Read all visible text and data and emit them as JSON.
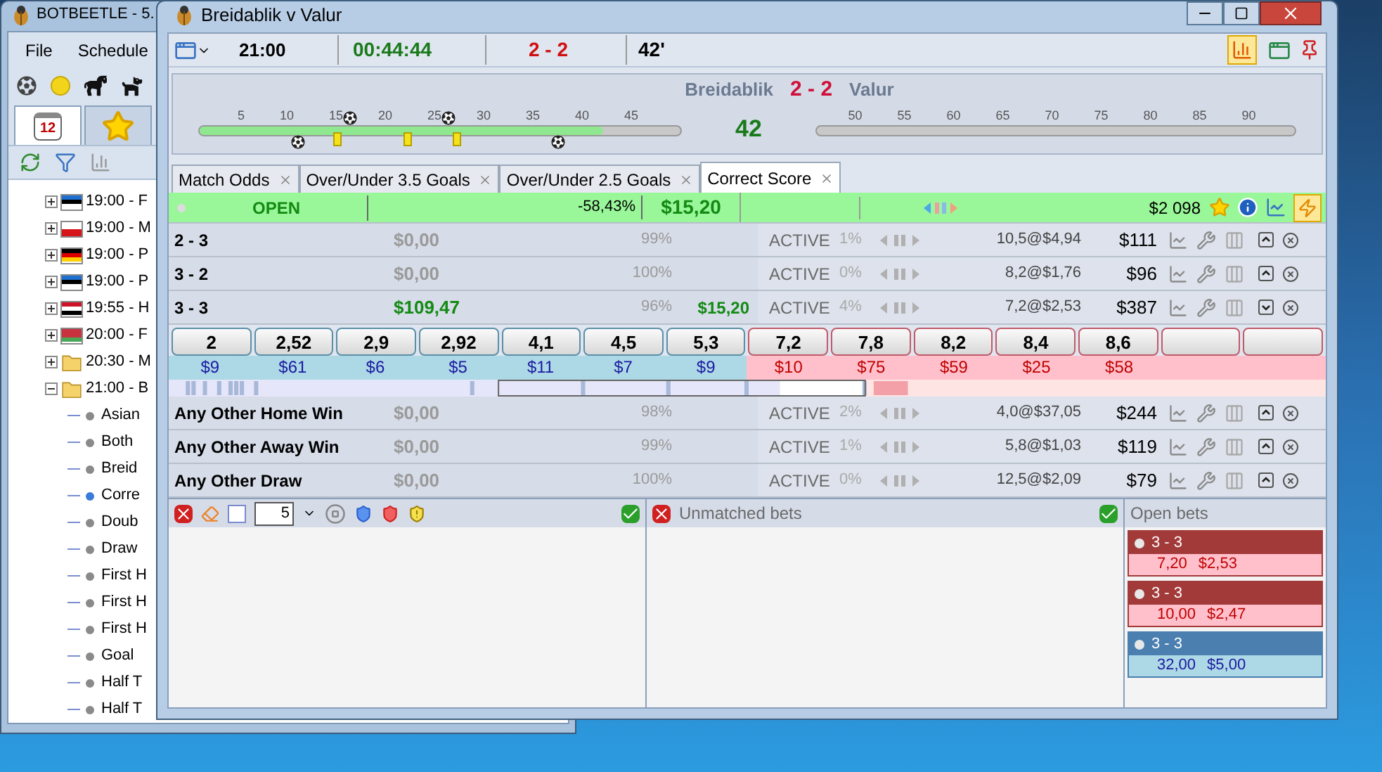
{
  "background_window": {
    "title": "BOTBEETLE - 5.",
    "menu": [
      "File",
      "Schedule"
    ],
    "tabs": [
      {
        "kind": "calendar",
        "label": "12",
        "selected": true
      },
      {
        "kind": "favorites",
        "selected": false
      }
    ],
    "tree": [
      {
        "label": "19:00 - F",
        "kind": "flag",
        "expanded": false
      },
      {
        "label": "19:00 - M",
        "kind": "flag",
        "expanded": false
      },
      {
        "label": "19:00 - P",
        "kind": "flag",
        "expanded": false
      },
      {
        "label": "19:00 - P",
        "kind": "flag",
        "expanded": false
      },
      {
        "label": "19:55 - H",
        "kind": "flag",
        "expanded": false
      },
      {
        "label": "20:00 - F",
        "kind": "flag",
        "expanded": false
      },
      {
        "label": "20:30 - M",
        "kind": "folder",
        "expanded": false
      },
      {
        "label": "21:00 - B",
        "kind": "folder",
        "expanded": true,
        "children": [
          {
            "label": "Asian",
            "selected": false
          },
          {
            "label": "Both",
            "selected": false
          },
          {
            "label": "Breid",
            "selected": false
          },
          {
            "label": "Corre",
            "selected": true
          },
          {
            "label": "Doub",
            "selected": false
          },
          {
            "label": "Draw",
            "selected": false
          },
          {
            "label": "First H",
            "selected": false
          },
          {
            "label": "First H",
            "selected": false
          },
          {
            "label": "First H",
            "selected": false
          },
          {
            "label": "Goal",
            "selected": false
          },
          {
            "label": "Half T",
            "selected": false
          },
          {
            "label": "Half T",
            "selected": false
          }
        ]
      }
    ]
  },
  "window": {
    "title": "Breidablik v Valur"
  },
  "toolbar": {
    "start_time": "21:00",
    "elapsed": "00:44:44",
    "score": "2 - 2",
    "minute": "42'",
    "chart_view": {
      "on": true
    }
  },
  "timeline": {
    "home": "Breidablik",
    "score": "2 - 2",
    "away": "Valur",
    "minute": "42",
    "first_half_ticks": [
      "5",
      "10",
      "15",
      "20",
      "25",
      "30",
      "35",
      "40",
      "45"
    ],
    "second_half_ticks": [
      "50",
      "55",
      "60",
      "65",
      "70",
      "75",
      "80",
      "85",
      "90"
    ],
    "progress": {
      "level": 0.84
    }
  },
  "tabs": [
    {
      "label": "Match Odds",
      "selected": false
    },
    {
      "label": "Over/Under 3.5 Goals",
      "selected": false
    },
    {
      "label": "Over/Under 2.5 Goals",
      "selected": false
    },
    {
      "label": "Correct Score",
      "selected": true
    }
  ],
  "market": {
    "status": "OPEN",
    "book_percent": "-58,43%",
    "profit": "$15,20",
    "matched": "$2 098",
    "auto_bet": {
      "on": true
    }
  },
  "runners": [
    {
      "name": "2 - 3",
      "pl": "$0,00",
      "positive": false,
      "percent": "99%",
      "status": "ACTIVE",
      "change": "1%",
      "last": "10,5@$4,94",
      "volume": "$111",
      "expanded": false
    },
    {
      "name": "3 - 2",
      "pl": "$0,00",
      "positive": false,
      "percent": "100%",
      "status": "ACTIVE",
      "change": "0%",
      "last": "8,2@$1,76",
      "volume": "$96",
      "expanded": false
    },
    {
      "name": "3 - 3",
      "pl": "$109,47",
      "positive": true,
      "percent": "96%",
      "hedge": "$15,20",
      "status": "ACTIVE",
      "change": "4%",
      "last": "7,2@$2,53",
      "volume": "$387",
      "expanded": true,
      "ladder": [
        {
          "price": "2",
          "amount": "$9",
          "kind": "back"
        },
        {
          "price": "2,52",
          "amount": "$61",
          "kind": "back"
        },
        {
          "price": "2,9",
          "amount": "$6",
          "kind": "back"
        },
        {
          "price": "2,92",
          "amount": "$5",
          "kind": "back"
        },
        {
          "price": "4,1",
          "amount": "$11",
          "kind": "back"
        },
        {
          "price": "4,5",
          "amount": "$7",
          "kind": "back"
        },
        {
          "price": "5,3",
          "amount": "$9",
          "kind": "back"
        },
        {
          "price": "7,2",
          "amount": "$10",
          "kind": "lay"
        },
        {
          "price": "7,8",
          "amount": "$75",
          "kind": "lay"
        },
        {
          "price": "8,2",
          "amount": "$59",
          "kind": "lay"
        },
        {
          "price": "8,4",
          "amount": "$25",
          "kind": "lay"
        },
        {
          "price": "8,6",
          "amount": "$58",
          "kind": "lay"
        },
        {
          "kind": "lay"
        },
        {
          "kind": "lay"
        }
      ]
    },
    {
      "name": "Any Other Home Win",
      "pl": "$0,00",
      "positive": false,
      "percent": "98%",
      "status": "ACTIVE",
      "change": "2%",
      "last": "4,0@$37,05",
      "volume": "$244",
      "expanded": false
    },
    {
      "name": "Any Other Away Win",
      "pl": "$0,00",
      "positive": false,
      "percent": "99%",
      "status": "ACTIVE",
      "change": "1%",
      "last": "5,8@$1,03",
      "volume": "$119",
      "expanded": false
    },
    {
      "name": "Any Other Draw",
      "pl": "$0,00",
      "positive": false,
      "percent": "100%",
      "status": "ACTIVE",
      "change": "0%",
      "last": "12,5@$2,09",
      "volume": "$79",
      "expanded": false
    }
  ],
  "bet_panel": {
    "stake": "5"
  },
  "unmatched": {
    "title": "Unmatched bets"
  },
  "open_bets": {
    "title": "Open bets",
    "bets": [
      {
        "runner": "3 - 3",
        "odds": "7,20",
        "stake": "$2,53",
        "kind": "lay"
      },
      {
        "runner": "3 - 3",
        "odds": "10,00",
        "stake": "$2,47",
        "kind": "lay"
      },
      {
        "runner": "3 - 3",
        "odds": "32,00",
        "stake": "$5,00",
        "kind": "back"
      }
    ]
  }
}
